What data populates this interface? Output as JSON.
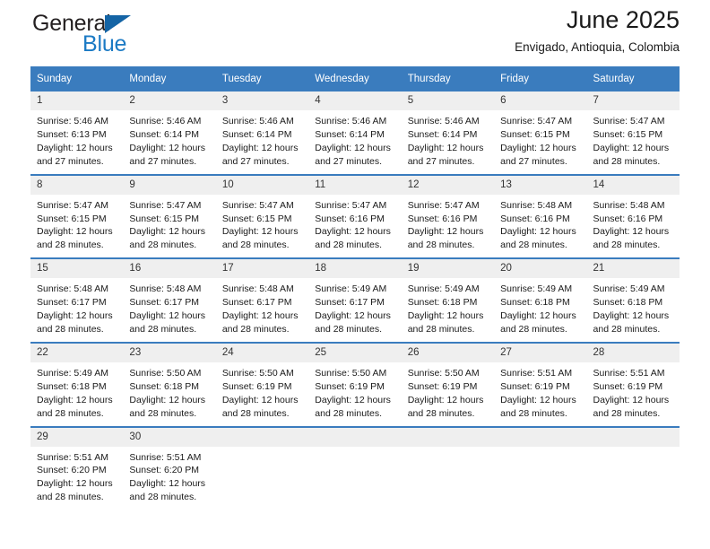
{
  "brand": {
    "name_part1": "General",
    "name_part2": "Blue",
    "triangle_color": "#1464a5",
    "blue_color": "#1b7ac4"
  },
  "header": {
    "title": "June 2025",
    "subtitle": "Envigado, Antioquia, Colombia"
  },
  "theme": {
    "header_blue": "#3a7cbe",
    "daynum_band": "#efefef",
    "text": "#1a1a1a"
  },
  "weekdays": [
    "Sunday",
    "Monday",
    "Tuesday",
    "Wednesday",
    "Thursday",
    "Friday",
    "Saturday"
  ],
  "weeks": [
    [
      {
        "day": "1",
        "sunrise": "Sunrise: 5:46 AM",
        "sunset": "Sunset: 6:13 PM",
        "daylight_line1": "Daylight: 12 hours",
        "daylight_line2": "and 27 minutes."
      },
      {
        "day": "2",
        "sunrise": "Sunrise: 5:46 AM",
        "sunset": "Sunset: 6:14 PM",
        "daylight_line1": "Daylight: 12 hours",
        "daylight_line2": "and 27 minutes."
      },
      {
        "day": "3",
        "sunrise": "Sunrise: 5:46 AM",
        "sunset": "Sunset: 6:14 PM",
        "daylight_line1": "Daylight: 12 hours",
        "daylight_line2": "and 27 minutes."
      },
      {
        "day": "4",
        "sunrise": "Sunrise: 5:46 AM",
        "sunset": "Sunset: 6:14 PM",
        "daylight_line1": "Daylight: 12 hours",
        "daylight_line2": "and 27 minutes."
      },
      {
        "day": "5",
        "sunrise": "Sunrise: 5:46 AM",
        "sunset": "Sunset: 6:14 PM",
        "daylight_line1": "Daylight: 12 hours",
        "daylight_line2": "and 27 minutes."
      },
      {
        "day": "6",
        "sunrise": "Sunrise: 5:47 AM",
        "sunset": "Sunset: 6:15 PM",
        "daylight_line1": "Daylight: 12 hours",
        "daylight_line2": "and 27 minutes."
      },
      {
        "day": "7",
        "sunrise": "Sunrise: 5:47 AM",
        "sunset": "Sunset: 6:15 PM",
        "daylight_line1": "Daylight: 12 hours",
        "daylight_line2": "and 28 minutes."
      }
    ],
    [
      {
        "day": "8",
        "sunrise": "Sunrise: 5:47 AM",
        "sunset": "Sunset: 6:15 PM",
        "daylight_line1": "Daylight: 12 hours",
        "daylight_line2": "and 28 minutes."
      },
      {
        "day": "9",
        "sunrise": "Sunrise: 5:47 AM",
        "sunset": "Sunset: 6:15 PM",
        "daylight_line1": "Daylight: 12 hours",
        "daylight_line2": "and 28 minutes."
      },
      {
        "day": "10",
        "sunrise": "Sunrise: 5:47 AM",
        "sunset": "Sunset: 6:15 PM",
        "daylight_line1": "Daylight: 12 hours",
        "daylight_line2": "and 28 minutes."
      },
      {
        "day": "11",
        "sunrise": "Sunrise: 5:47 AM",
        "sunset": "Sunset: 6:16 PM",
        "daylight_line1": "Daylight: 12 hours",
        "daylight_line2": "and 28 minutes."
      },
      {
        "day": "12",
        "sunrise": "Sunrise: 5:47 AM",
        "sunset": "Sunset: 6:16 PM",
        "daylight_line1": "Daylight: 12 hours",
        "daylight_line2": "and 28 minutes."
      },
      {
        "day": "13",
        "sunrise": "Sunrise: 5:48 AM",
        "sunset": "Sunset: 6:16 PM",
        "daylight_line1": "Daylight: 12 hours",
        "daylight_line2": "and 28 minutes."
      },
      {
        "day": "14",
        "sunrise": "Sunrise: 5:48 AM",
        "sunset": "Sunset: 6:16 PM",
        "daylight_line1": "Daylight: 12 hours",
        "daylight_line2": "and 28 minutes."
      }
    ],
    [
      {
        "day": "15",
        "sunrise": "Sunrise: 5:48 AM",
        "sunset": "Sunset: 6:17 PM",
        "daylight_line1": "Daylight: 12 hours",
        "daylight_line2": "and 28 minutes."
      },
      {
        "day": "16",
        "sunrise": "Sunrise: 5:48 AM",
        "sunset": "Sunset: 6:17 PM",
        "daylight_line1": "Daylight: 12 hours",
        "daylight_line2": "and 28 minutes."
      },
      {
        "day": "17",
        "sunrise": "Sunrise: 5:48 AM",
        "sunset": "Sunset: 6:17 PM",
        "daylight_line1": "Daylight: 12 hours",
        "daylight_line2": "and 28 minutes."
      },
      {
        "day": "18",
        "sunrise": "Sunrise: 5:49 AM",
        "sunset": "Sunset: 6:17 PM",
        "daylight_line1": "Daylight: 12 hours",
        "daylight_line2": "and 28 minutes."
      },
      {
        "day": "19",
        "sunrise": "Sunrise: 5:49 AM",
        "sunset": "Sunset: 6:18 PM",
        "daylight_line1": "Daylight: 12 hours",
        "daylight_line2": "and 28 minutes."
      },
      {
        "day": "20",
        "sunrise": "Sunrise: 5:49 AM",
        "sunset": "Sunset: 6:18 PM",
        "daylight_line1": "Daylight: 12 hours",
        "daylight_line2": "and 28 minutes."
      },
      {
        "day": "21",
        "sunrise": "Sunrise: 5:49 AM",
        "sunset": "Sunset: 6:18 PM",
        "daylight_line1": "Daylight: 12 hours",
        "daylight_line2": "and 28 minutes."
      }
    ],
    [
      {
        "day": "22",
        "sunrise": "Sunrise: 5:49 AM",
        "sunset": "Sunset: 6:18 PM",
        "daylight_line1": "Daylight: 12 hours",
        "daylight_line2": "and 28 minutes."
      },
      {
        "day": "23",
        "sunrise": "Sunrise: 5:50 AM",
        "sunset": "Sunset: 6:18 PM",
        "daylight_line1": "Daylight: 12 hours",
        "daylight_line2": "and 28 minutes."
      },
      {
        "day": "24",
        "sunrise": "Sunrise: 5:50 AM",
        "sunset": "Sunset: 6:19 PM",
        "daylight_line1": "Daylight: 12 hours",
        "daylight_line2": "and 28 minutes."
      },
      {
        "day": "25",
        "sunrise": "Sunrise: 5:50 AM",
        "sunset": "Sunset: 6:19 PM",
        "daylight_line1": "Daylight: 12 hours",
        "daylight_line2": "and 28 minutes."
      },
      {
        "day": "26",
        "sunrise": "Sunrise: 5:50 AM",
        "sunset": "Sunset: 6:19 PM",
        "daylight_line1": "Daylight: 12 hours",
        "daylight_line2": "and 28 minutes."
      },
      {
        "day": "27",
        "sunrise": "Sunrise: 5:51 AM",
        "sunset": "Sunset: 6:19 PM",
        "daylight_line1": "Daylight: 12 hours",
        "daylight_line2": "and 28 minutes."
      },
      {
        "day": "28",
        "sunrise": "Sunrise: 5:51 AM",
        "sunset": "Sunset: 6:19 PM",
        "daylight_line1": "Daylight: 12 hours",
        "daylight_line2": "and 28 minutes."
      }
    ],
    [
      {
        "day": "29",
        "sunrise": "Sunrise: 5:51 AM",
        "sunset": "Sunset: 6:20 PM",
        "daylight_line1": "Daylight: 12 hours",
        "daylight_line2": "and 28 minutes."
      },
      {
        "day": "30",
        "sunrise": "Sunrise: 5:51 AM",
        "sunset": "Sunset: 6:20 PM",
        "daylight_line1": "Daylight: 12 hours",
        "daylight_line2": "and 28 minutes."
      },
      {
        "day": "",
        "sunrise": "",
        "sunset": "",
        "daylight_line1": "",
        "daylight_line2": ""
      },
      {
        "day": "",
        "sunrise": "",
        "sunset": "",
        "daylight_line1": "",
        "daylight_line2": ""
      },
      {
        "day": "",
        "sunrise": "",
        "sunset": "",
        "daylight_line1": "",
        "daylight_line2": ""
      },
      {
        "day": "",
        "sunrise": "",
        "sunset": "",
        "daylight_line1": "",
        "daylight_line2": ""
      },
      {
        "day": "",
        "sunrise": "",
        "sunset": "",
        "daylight_line1": "",
        "daylight_line2": ""
      }
    ]
  ]
}
